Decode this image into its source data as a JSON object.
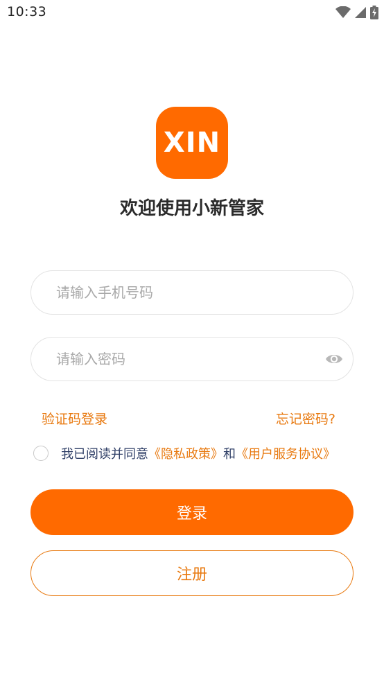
{
  "status_bar": {
    "time": "10:33",
    "icons": [
      "wifi-icon",
      "cellular-signal-icon",
      "battery-charging-icon"
    ]
  },
  "logo": {
    "text": "XIN",
    "color": "#FF6A00"
  },
  "welcome_title": "欢迎使用小新管家",
  "phone_input": {
    "value": "",
    "placeholder": "请输入手机号码"
  },
  "password_input": {
    "value": "",
    "placeholder": "请输入密码",
    "toggle_icon": "eye-icon"
  },
  "links": {
    "sms_login": "验证码登录",
    "forgot_password": "忘记密码?"
  },
  "agreement": {
    "checked": false,
    "prefix": "我已阅读并同意",
    "privacy_policy": "《隐私政策》",
    "conjunction": "和",
    "user_agreement": "《用户服务协议》"
  },
  "buttons": {
    "login": "登录",
    "register": "注册"
  },
  "colors": {
    "accent": "#FF6A00",
    "link": "#E8790F",
    "agreement_text": "#2E3E66"
  }
}
